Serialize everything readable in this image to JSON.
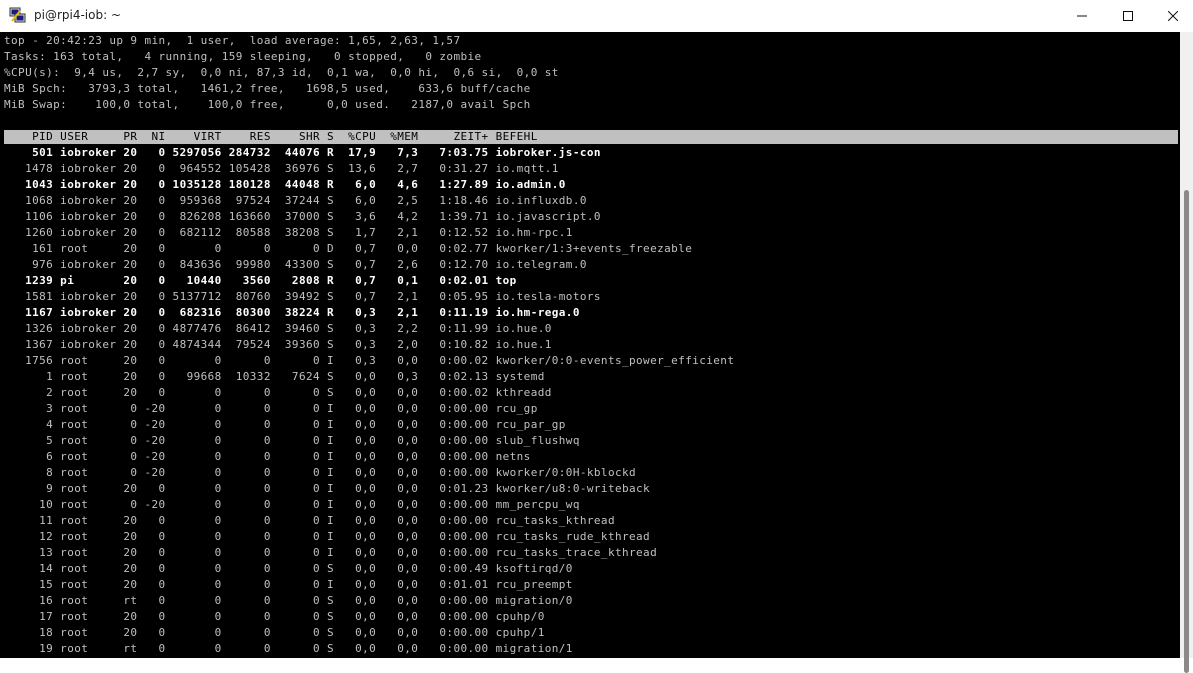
{
  "window": {
    "title": "pi@rpi4-iob: ~",
    "icon": "putty-icon"
  },
  "summary": [
    "top - 20:42:23 up 9 min,  1 user,  load average: 1,65, 2,63, 1,57",
    "Tasks: 163 total,   4 running, 159 sleeping,   0 stopped,   0 zombie",
    "%CPU(s):  9,4 us,  2,7 sy,  0,0 ni, 87,3 id,  0,1 wa,  0,0 hi,  0,6 si,  0,0 st",
    "MiB Spch:   3793,3 total,   1461,2 free,   1698,5 used,    633,6 buff/cache",
    "MiB Swap:    100,0 total,    100,0 free,      0,0 used.   2187,0 avail Spch"
  ],
  "columns": [
    "PID",
    "USER",
    "PR",
    "NI",
    "VIRT",
    "RES",
    "SHR",
    "S",
    "%CPU",
    "%MEM",
    "ZEIT+",
    "BEFEHL"
  ],
  "processes": [
    {
      "pid": "501",
      "user": "iobroker",
      "pr": "20",
      "ni": "0",
      "virt": "5297056",
      "res": "284732",
      "shr": "44076",
      "s": "R",
      "cpu": "17,9",
      "mem": "7,3",
      "time": "7:03.75",
      "cmd": "iobroker.js-con",
      "bold": true
    },
    {
      "pid": "1478",
      "user": "iobroker",
      "pr": "20",
      "ni": "0",
      "virt": "964552",
      "res": "105428",
      "shr": "36976",
      "s": "S",
      "cpu": "13,6",
      "mem": "2,7",
      "time": "0:31.27",
      "cmd": "io.mqtt.1",
      "bold": false
    },
    {
      "pid": "1043",
      "user": "iobroker",
      "pr": "20",
      "ni": "0",
      "virt": "1035128",
      "res": "180128",
      "shr": "44048",
      "s": "R",
      "cpu": "6,0",
      "mem": "4,6",
      "time": "1:27.89",
      "cmd": "io.admin.0",
      "bold": true
    },
    {
      "pid": "1068",
      "user": "iobroker",
      "pr": "20",
      "ni": "0",
      "virt": "959368",
      "res": "97524",
      "shr": "37244",
      "s": "S",
      "cpu": "6,0",
      "mem": "2,5",
      "time": "1:18.46",
      "cmd": "io.influxdb.0",
      "bold": false
    },
    {
      "pid": "1106",
      "user": "iobroker",
      "pr": "20",
      "ni": "0",
      "virt": "826208",
      "res": "163660",
      "shr": "37000",
      "s": "S",
      "cpu": "3,6",
      "mem": "4,2",
      "time": "1:39.71",
      "cmd": "io.javascript.0",
      "bold": false
    },
    {
      "pid": "1260",
      "user": "iobroker",
      "pr": "20",
      "ni": "0",
      "virt": "682112",
      "res": "80588",
      "shr": "38208",
      "s": "S",
      "cpu": "1,7",
      "mem": "2,1",
      "time": "0:12.52",
      "cmd": "io.hm-rpc.1",
      "bold": false
    },
    {
      "pid": "161",
      "user": "root",
      "pr": "20",
      "ni": "0",
      "virt": "0",
      "res": "0",
      "shr": "0",
      "s": "D",
      "cpu": "0,7",
      "mem": "0,0",
      "time": "0:02.77",
      "cmd": "kworker/1:3+events_freezable",
      "bold": false
    },
    {
      "pid": "976",
      "user": "iobroker",
      "pr": "20",
      "ni": "0",
      "virt": "843636",
      "res": "99980",
      "shr": "43300",
      "s": "S",
      "cpu": "0,7",
      "mem": "2,6",
      "time": "0:12.70",
      "cmd": "io.telegram.0",
      "bold": false
    },
    {
      "pid": "1239",
      "user": "pi",
      "pr": "20",
      "ni": "0",
      "virt": "10440",
      "res": "3560",
      "shr": "2808",
      "s": "R",
      "cpu": "0,7",
      "mem": "0,1",
      "time": "0:02.01",
      "cmd": "top",
      "bold": true
    },
    {
      "pid": "1581",
      "user": "iobroker",
      "pr": "20",
      "ni": "0",
      "virt": "5137712",
      "res": "80760",
      "shr": "39492",
      "s": "S",
      "cpu": "0,7",
      "mem": "2,1",
      "time": "0:05.95",
      "cmd": "io.tesla-motors",
      "bold": false
    },
    {
      "pid": "1167",
      "user": "iobroker",
      "pr": "20",
      "ni": "0",
      "virt": "682316",
      "res": "80300",
      "shr": "38224",
      "s": "R",
      "cpu": "0,3",
      "mem": "2,1",
      "time": "0:11.19",
      "cmd": "io.hm-rega.0",
      "bold": true
    },
    {
      "pid": "1326",
      "user": "iobroker",
      "pr": "20",
      "ni": "0",
      "virt": "4877476",
      "res": "86412",
      "shr": "39460",
      "s": "S",
      "cpu": "0,3",
      "mem": "2,2",
      "time": "0:11.99",
      "cmd": "io.hue.0",
      "bold": false
    },
    {
      "pid": "1367",
      "user": "iobroker",
      "pr": "20",
      "ni": "0",
      "virt": "4874344",
      "res": "79524",
      "shr": "39360",
      "s": "S",
      "cpu": "0,3",
      "mem": "2,0",
      "time": "0:10.82",
      "cmd": "io.hue.1",
      "bold": false
    },
    {
      "pid": "1756",
      "user": "root",
      "pr": "20",
      "ni": "0",
      "virt": "0",
      "res": "0",
      "shr": "0",
      "s": "I",
      "cpu": "0,3",
      "mem": "0,0",
      "time": "0:00.02",
      "cmd": "kworker/0:0-events_power_efficient",
      "bold": false
    },
    {
      "pid": "1",
      "user": "root",
      "pr": "20",
      "ni": "0",
      "virt": "99668",
      "res": "10332",
      "shr": "7624",
      "s": "S",
      "cpu": "0,0",
      "mem": "0,3",
      "time": "0:02.13",
      "cmd": "systemd",
      "bold": false
    },
    {
      "pid": "2",
      "user": "root",
      "pr": "20",
      "ni": "0",
      "virt": "0",
      "res": "0",
      "shr": "0",
      "s": "S",
      "cpu": "0,0",
      "mem": "0,0",
      "time": "0:00.02",
      "cmd": "kthreadd",
      "bold": false
    },
    {
      "pid": "3",
      "user": "root",
      "pr": "0",
      "ni": "-20",
      "virt": "0",
      "res": "0",
      "shr": "0",
      "s": "I",
      "cpu": "0,0",
      "mem": "0,0",
      "time": "0:00.00",
      "cmd": "rcu_gp",
      "bold": false
    },
    {
      "pid": "4",
      "user": "root",
      "pr": "0",
      "ni": "-20",
      "virt": "0",
      "res": "0",
      "shr": "0",
      "s": "I",
      "cpu": "0,0",
      "mem": "0,0",
      "time": "0:00.00",
      "cmd": "rcu_par_gp",
      "bold": false
    },
    {
      "pid": "5",
      "user": "root",
      "pr": "0",
      "ni": "-20",
      "virt": "0",
      "res": "0",
      "shr": "0",
      "s": "I",
      "cpu": "0,0",
      "mem": "0,0",
      "time": "0:00.00",
      "cmd": "slub_flushwq",
      "bold": false
    },
    {
      "pid": "6",
      "user": "root",
      "pr": "0",
      "ni": "-20",
      "virt": "0",
      "res": "0",
      "shr": "0",
      "s": "I",
      "cpu": "0,0",
      "mem": "0,0",
      "time": "0:00.00",
      "cmd": "netns",
      "bold": false
    },
    {
      "pid": "8",
      "user": "root",
      "pr": "0",
      "ni": "-20",
      "virt": "0",
      "res": "0",
      "shr": "0",
      "s": "I",
      "cpu": "0,0",
      "mem": "0,0",
      "time": "0:00.00",
      "cmd": "kworker/0:0H-kblockd",
      "bold": false
    },
    {
      "pid": "9",
      "user": "root",
      "pr": "20",
      "ni": "0",
      "virt": "0",
      "res": "0",
      "shr": "0",
      "s": "I",
      "cpu": "0,0",
      "mem": "0,0",
      "time": "0:01.23",
      "cmd": "kworker/u8:0-writeback",
      "bold": false
    },
    {
      "pid": "10",
      "user": "root",
      "pr": "0",
      "ni": "-20",
      "virt": "0",
      "res": "0",
      "shr": "0",
      "s": "I",
      "cpu": "0,0",
      "mem": "0,0",
      "time": "0:00.00",
      "cmd": "mm_percpu_wq",
      "bold": false
    },
    {
      "pid": "11",
      "user": "root",
      "pr": "20",
      "ni": "0",
      "virt": "0",
      "res": "0",
      "shr": "0",
      "s": "I",
      "cpu": "0,0",
      "mem": "0,0",
      "time": "0:00.00",
      "cmd": "rcu_tasks_kthread",
      "bold": false
    },
    {
      "pid": "12",
      "user": "root",
      "pr": "20",
      "ni": "0",
      "virt": "0",
      "res": "0",
      "shr": "0",
      "s": "I",
      "cpu": "0,0",
      "mem": "0,0",
      "time": "0:00.00",
      "cmd": "rcu_tasks_rude_kthread",
      "bold": false
    },
    {
      "pid": "13",
      "user": "root",
      "pr": "20",
      "ni": "0",
      "virt": "0",
      "res": "0",
      "shr": "0",
      "s": "I",
      "cpu": "0,0",
      "mem": "0,0",
      "time": "0:00.00",
      "cmd": "rcu_tasks_trace_kthread",
      "bold": false
    },
    {
      "pid": "14",
      "user": "root",
      "pr": "20",
      "ni": "0",
      "virt": "0",
      "res": "0",
      "shr": "0",
      "s": "S",
      "cpu": "0,0",
      "mem": "0,0",
      "time": "0:00.49",
      "cmd": "ksoftirqd/0",
      "bold": false
    },
    {
      "pid": "15",
      "user": "root",
      "pr": "20",
      "ni": "0",
      "virt": "0",
      "res": "0",
      "shr": "0",
      "s": "I",
      "cpu": "0,0",
      "mem": "0,0",
      "time": "0:01.01",
      "cmd": "rcu_preempt",
      "bold": false
    },
    {
      "pid": "16",
      "user": "root",
      "pr": "rt",
      "ni": "0",
      "virt": "0",
      "res": "0",
      "shr": "0",
      "s": "S",
      "cpu": "0,0",
      "mem": "0,0",
      "time": "0:00.00",
      "cmd": "migration/0",
      "bold": false
    },
    {
      "pid": "17",
      "user": "root",
      "pr": "20",
      "ni": "0",
      "virt": "0",
      "res": "0",
      "shr": "0",
      "s": "S",
      "cpu": "0,0",
      "mem": "0,0",
      "time": "0:00.00",
      "cmd": "cpuhp/0",
      "bold": false
    },
    {
      "pid": "18",
      "user": "root",
      "pr": "20",
      "ni": "0",
      "virt": "0",
      "res": "0",
      "shr": "0",
      "s": "S",
      "cpu": "0,0",
      "mem": "0,0",
      "time": "0:00.00",
      "cmd": "cpuhp/1",
      "bold": false
    },
    {
      "pid": "19",
      "user": "root",
      "pr": "rt",
      "ni": "0",
      "virt": "0",
      "res": "0",
      "shr": "0",
      "s": "S",
      "cpu": "0,0",
      "mem": "0,0",
      "time": "0:00.00",
      "cmd": "migration/1",
      "bold": false
    }
  ],
  "colors": {
    "terminal_bg": "#000000",
    "terminal_fg": "#c0c0c0",
    "header_bar": "#c0c0c0"
  }
}
